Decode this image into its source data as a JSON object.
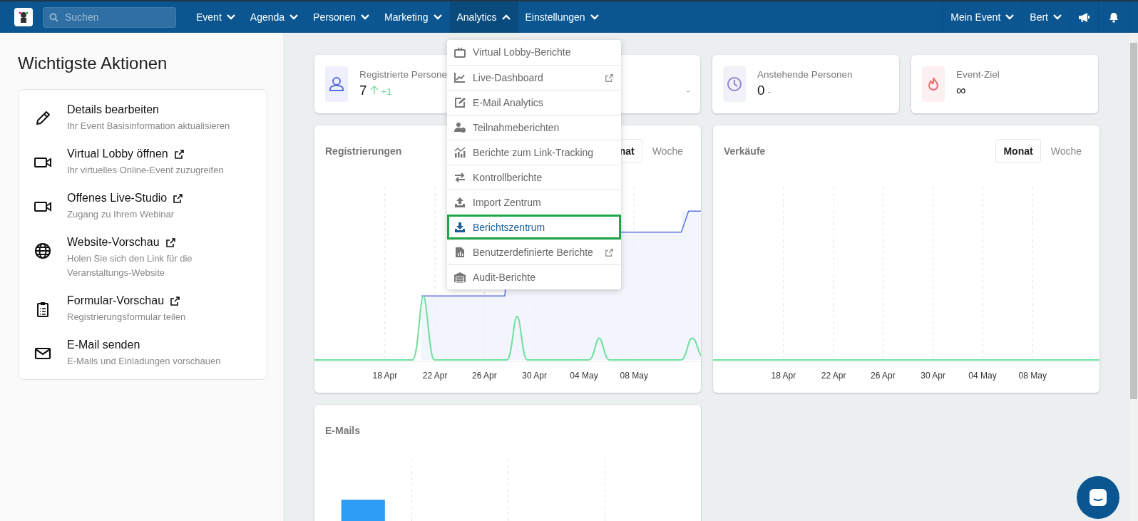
{
  "nav": {
    "search": {
      "placeholder": "Suchen"
    },
    "menus": [
      {
        "label": "Event",
        "expanded": false
      },
      {
        "label": "Agenda",
        "expanded": false
      },
      {
        "label": "Personen",
        "expanded": false
      },
      {
        "label": "Marketing",
        "expanded": false
      },
      {
        "label": "Analytics",
        "expanded": true
      },
      {
        "label": "Einstellungen",
        "expanded": false
      }
    ],
    "right_menus": [
      {
        "label": "Mein Event"
      },
      {
        "label": "Bert"
      }
    ]
  },
  "analytics_menu": [
    {
      "label": "Virtual Lobby-Berichte",
      "kind": "tv",
      "external": false,
      "highlighted": false
    },
    {
      "label": "Live-Dashboard",
      "kind": "chart",
      "external": true,
      "highlighted": false
    },
    {
      "label": "E-Mail Analytics",
      "kind": "edit",
      "external": false,
      "highlighted": false
    },
    {
      "label": "Teilnahmeberichten",
      "kind": "user",
      "external": false,
      "highlighted": false
    },
    {
      "label": "Berichte zum Link-Tracking",
      "kind": "bars",
      "external": false,
      "highlighted": false
    },
    {
      "label": "Kontrollberichte",
      "kind": "swap",
      "external": false,
      "highlighted": false
    },
    {
      "label": "Import Zentrum",
      "kind": "upload",
      "external": false,
      "highlighted": false
    },
    {
      "label": "Berichtszentrum",
      "kind": "download",
      "external": false,
      "highlighted": true
    },
    {
      "label": "Benutzerdefinierte Berichte",
      "kind": "file",
      "external": true,
      "highlighted": false
    },
    {
      "label": "Audit-Berichte",
      "kind": "warehouse",
      "external": false,
      "highlighted": false
    }
  ],
  "actions": {
    "title": "Wichtigste Aktionen",
    "items": [
      {
        "title": "Details bearbeiten",
        "subtitle": "Ihr Event Basisinformation aktualisieren",
        "kind": "pencil",
        "external": false
      },
      {
        "title": "Virtual Lobby öffnen",
        "subtitle": "Ihr virtuelles Online-Event zuzugreifen",
        "kind": "video",
        "external": true
      },
      {
        "title": "Offenes Live-Studio",
        "subtitle": "Zugang zu Ihrem Webinar",
        "kind": "video",
        "external": true
      },
      {
        "title": "Website-Vorschau",
        "subtitle": "Holen Sie sich den Link für die Veranstaltungs-Website",
        "kind": "globe",
        "external": true
      },
      {
        "title": "Formular-Vorschau",
        "subtitle": "Registrierungsformular teilen",
        "kind": "clipboard",
        "external": true
      },
      {
        "title": "E-Mail senden",
        "subtitle": "E-Mails und Einladungen vorschauen",
        "kind": "mail",
        "external": false
      }
    ]
  },
  "stats": [
    {
      "label": "Registrierte Persone",
      "value": "7",
      "delta": "+1",
      "rising": true,
      "kind": "person"
    },
    {
      "delta": "-",
      "rising": false
    },
    {
      "label": "Anstehende Personen",
      "value": "0",
      "delta": "-",
      "rising": false,
      "kind": "clock"
    },
    {
      "label": "Event-Ziel",
      "value": "∞",
      "kind": "flame"
    }
  ],
  "charts": [
    {
      "title": "Registrierungen",
      "kind": "registrations",
      "toggle": [
        {
          "label": "nat",
          "selected": true
        },
        {
          "label": "Woche",
          "selected": false
        }
      ],
      "x_labels": [
        "18 Apr",
        "22 Apr",
        "26 Apr",
        "30 Apr",
        "04 May",
        "08 May"
      ]
    },
    {
      "title": "Verkäufe",
      "kind": "flat",
      "toggle": [
        {
          "label": "Monat",
          "selected": true
        },
        {
          "label": "Woche",
          "selected": false
        }
      ],
      "x_labels": [
        "18 Apr",
        "22 Apr",
        "26 Apr",
        "30 Apr",
        "04 May",
        "08 May"
      ]
    },
    {
      "title": "E-Mails",
      "kind": "bar"
    }
  ]
}
